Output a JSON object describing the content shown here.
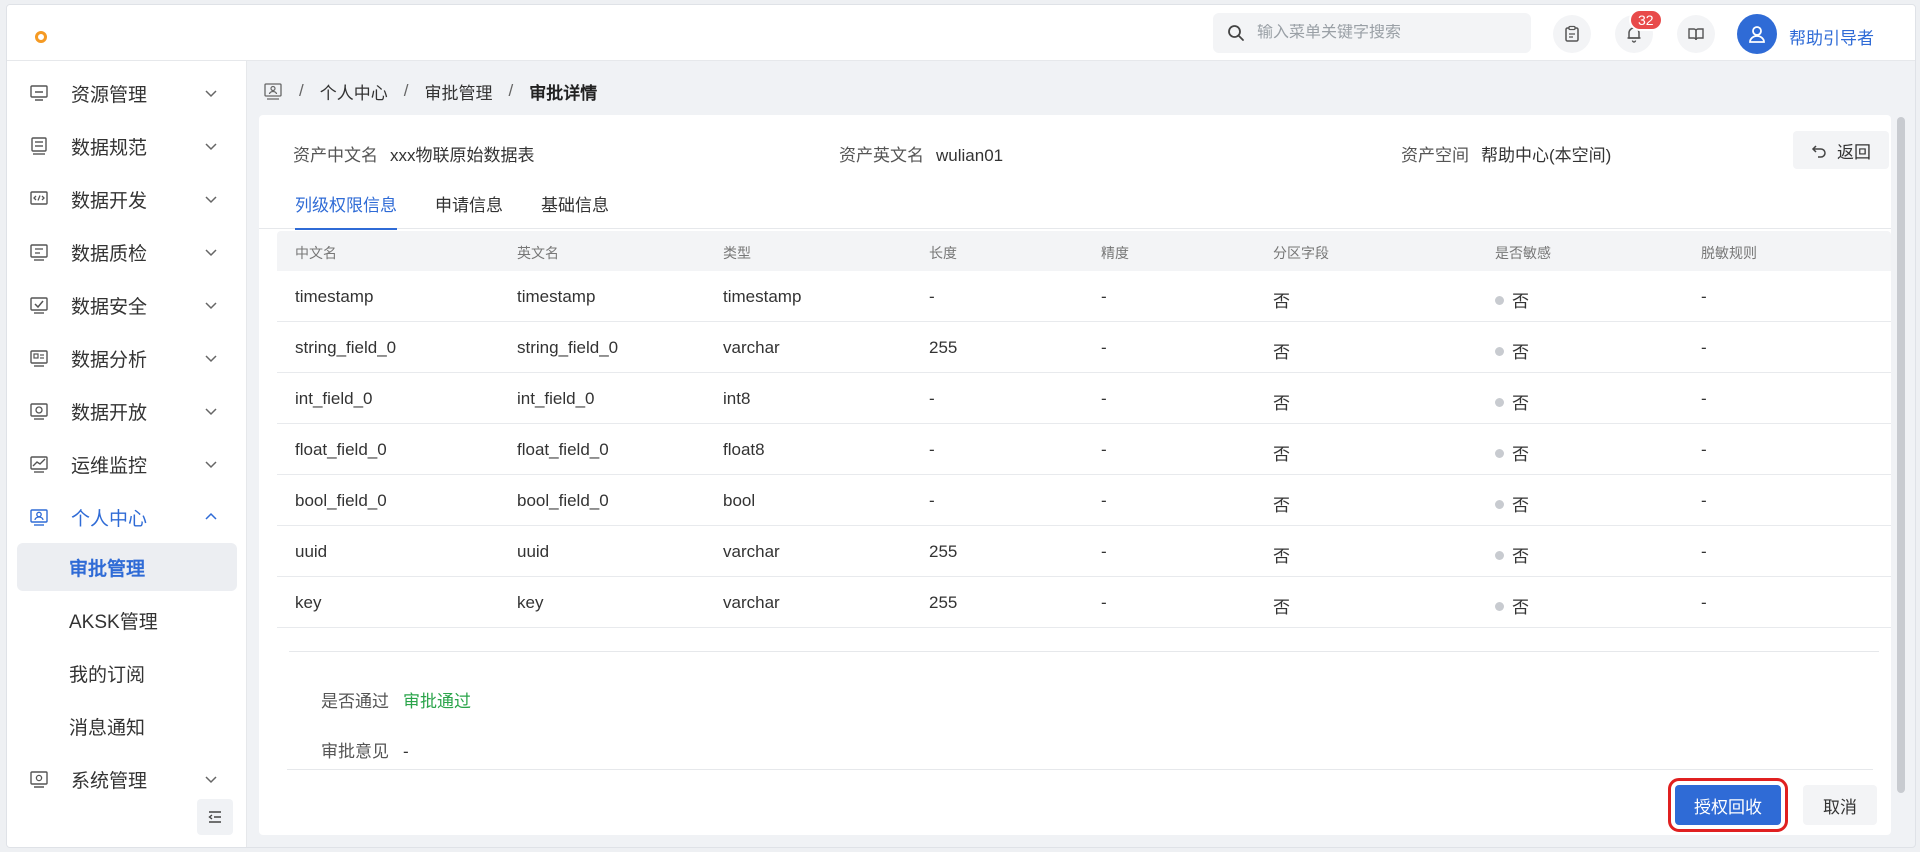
{
  "header": {
    "search_placeholder": "输入菜单关键字搜索",
    "notification_count": "32",
    "username": "帮助引导者"
  },
  "sidebar": {
    "items": [
      {
        "label": "资源管理",
        "icon": "resource-icon"
      },
      {
        "label": "数据规范",
        "icon": "database-icon"
      },
      {
        "label": "数据开发",
        "icon": "code-icon"
      },
      {
        "label": "数据质检",
        "icon": "inspection-icon"
      },
      {
        "label": "数据安全",
        "icon": "security-icon"
      },
      {
        "label": "数据分析",
        "icon": "analysis-icon"
      },
      {
        "label": "数据开放",
        "icon": "open-data-icon"
      },
      {
        "label": "运维监控",
        "icon": "monitor-icon"
      },
      {
        "label": "个人中心",
        "icon": "personal-icon"
      }
    ],
    "sub_items": [
      "审批管理",
      "AKSK管理",
      "我的订阅",
      "消息通知"
    ],
    "bottom_item": {
      "label": "系统管理",
      "icon": "system-icon"
    }
  },
  "breadcrumb": [
    "个人中心",
    "审批管理",
    "审批详情"
  ],
  "asset": {
    "cn_name_label": "资产中文名",
    "cn_name": "xxx物联原始数据表",
    "en_name_label": "资产英文名",
    "en_name": "wulian01",
    "space_label": "资产空间",
    "space": "帮助中心(本空间)",
    "back_label": "返回"
  },
  "tabs": [
    "列级权限信息",
    "申请信息",
    "基础信息"
  ],
  "table": {
    "columns": [
      "中文名",
      "英文名",
      "类型",
      "长度",
      "精度",
      "分区字段",
      "是否敏感",
      "脱敏规则"
    ],
    "rows": [
      [
        "timestamp",
        "timestamp",
        "timestamp",
        "-",
        "-",
        "否",
        "否",
        "-"
      ],
      [
        "string_field_0",
        "string_field_0",
        "varchar",
        "255",
        "-",
        "否",
        "否",
        "-"
      ],
      [
        "int_field_0",
        "int_field_0",
        "int8",
        "-",
        "-",
        "否",
        "否",
        "-"
      ],
      [
        "float_field_0",
        "float_field_0",
        "float8",
        "-",
        "-",
        "否",
        "否",
        "-"
      ],
      [
        "bool_field_0",
        "bool_field_0",
        "bool",
        "-",
        "-",
        "否",
        "否",
        "-"
      ],
      [
        "uuid",
        "uuid",
        "varchar",
        "255",
        "-",
        "否",
        "否",
        "-"
      ],
      [
        "key",
        "key",
        "varchar",
        "255",
        "-",
        "否",
        "否",
        "-"
      ]
    ]
  },
  "result": {
    "pass_label": "是否通过",
    "pass_value": "审批通过",
    "opinion_label": "审批意见",
    "opinion_value": "-"
  },
  "actions": {
    "revoke_label": "授权回收",
    "cancel_label": "取消"
  },
  "colors": {
    "accent": "#2f6bd6",
    "success": "#2aa44a",
    "badge": "#e84a4a",
    "highlight": "#e02020"
  }
}
